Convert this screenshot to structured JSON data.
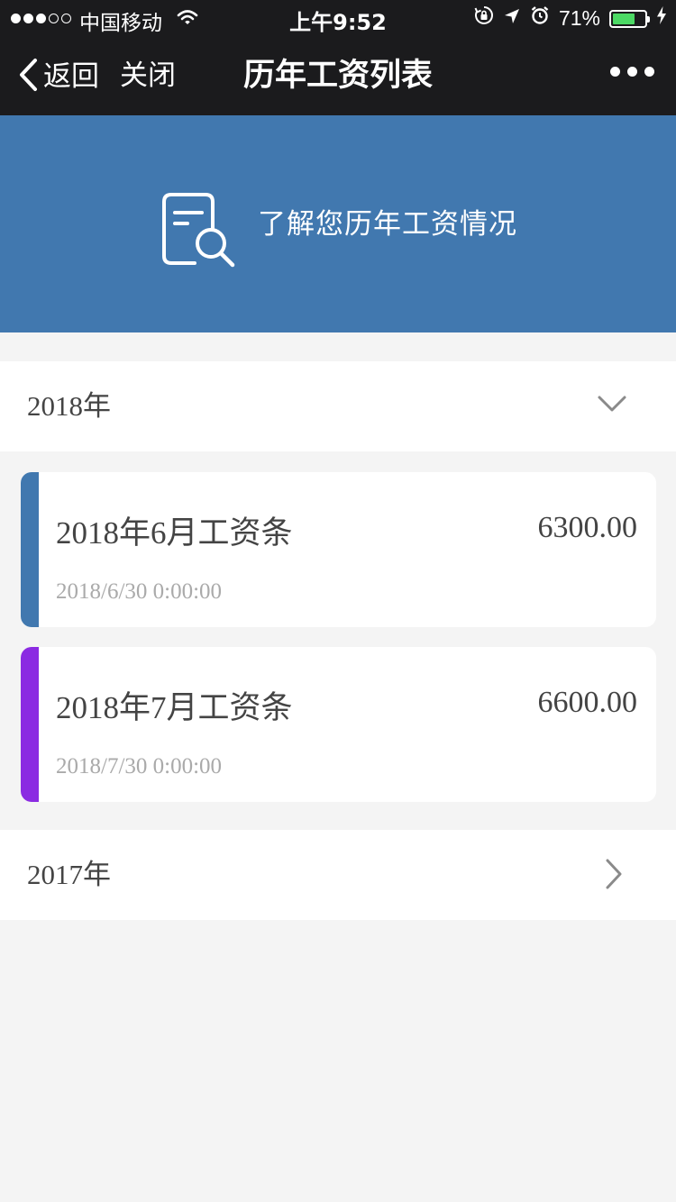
{
  "status_bar": {
    "signal_bars": 3,
    "signal_total": 5,
    "carrier": "中国移动",
    "time": "上午9:52",
    "battery_percent": "71%",
    "battery_level": 0.71,
    "icons": [
      "wifi-icon",
      "rotation-lock-icon",
      "location-arrow-icon",
      "alarm-icon",
      "battery-icon",
      "charging-bolt-icon"
    ]
  },
  "nav": {
    "back_label": "返回",
    "close_label": "关闭",
    "title": "历年工资列表",
    "icons": [
      "chevron-left-icon",
      "more-icon"
    ]
  },
  "banner": {
    "text": "了解您历年工资情况",
    "icon": "document-search-icon",
    "background_color": "#4178af"
  },
  "years": [
    {
      "label": "2018年",
      "expanded": true,
      "icon": "chevron-down-icon",
      "payslips": [
        {
          "title": "2018年6月工资条",
          "amount": "6300.00",
          "date": "2018/6/30 0:00:00",
          "accent_color": "#4178af"
        },
        {
          "title": "2018年7月工资条",
          "amount": "6600.00",
          "date": "2018/7/30 0:00:00",
          "accent_color": "#8b2be2"
        }
      ]
    },
    {
      "label": "2017年",
      "expanded": false,
      "icon": "chevron-right-icon",
      "payslips": []
    }
  ]
}
